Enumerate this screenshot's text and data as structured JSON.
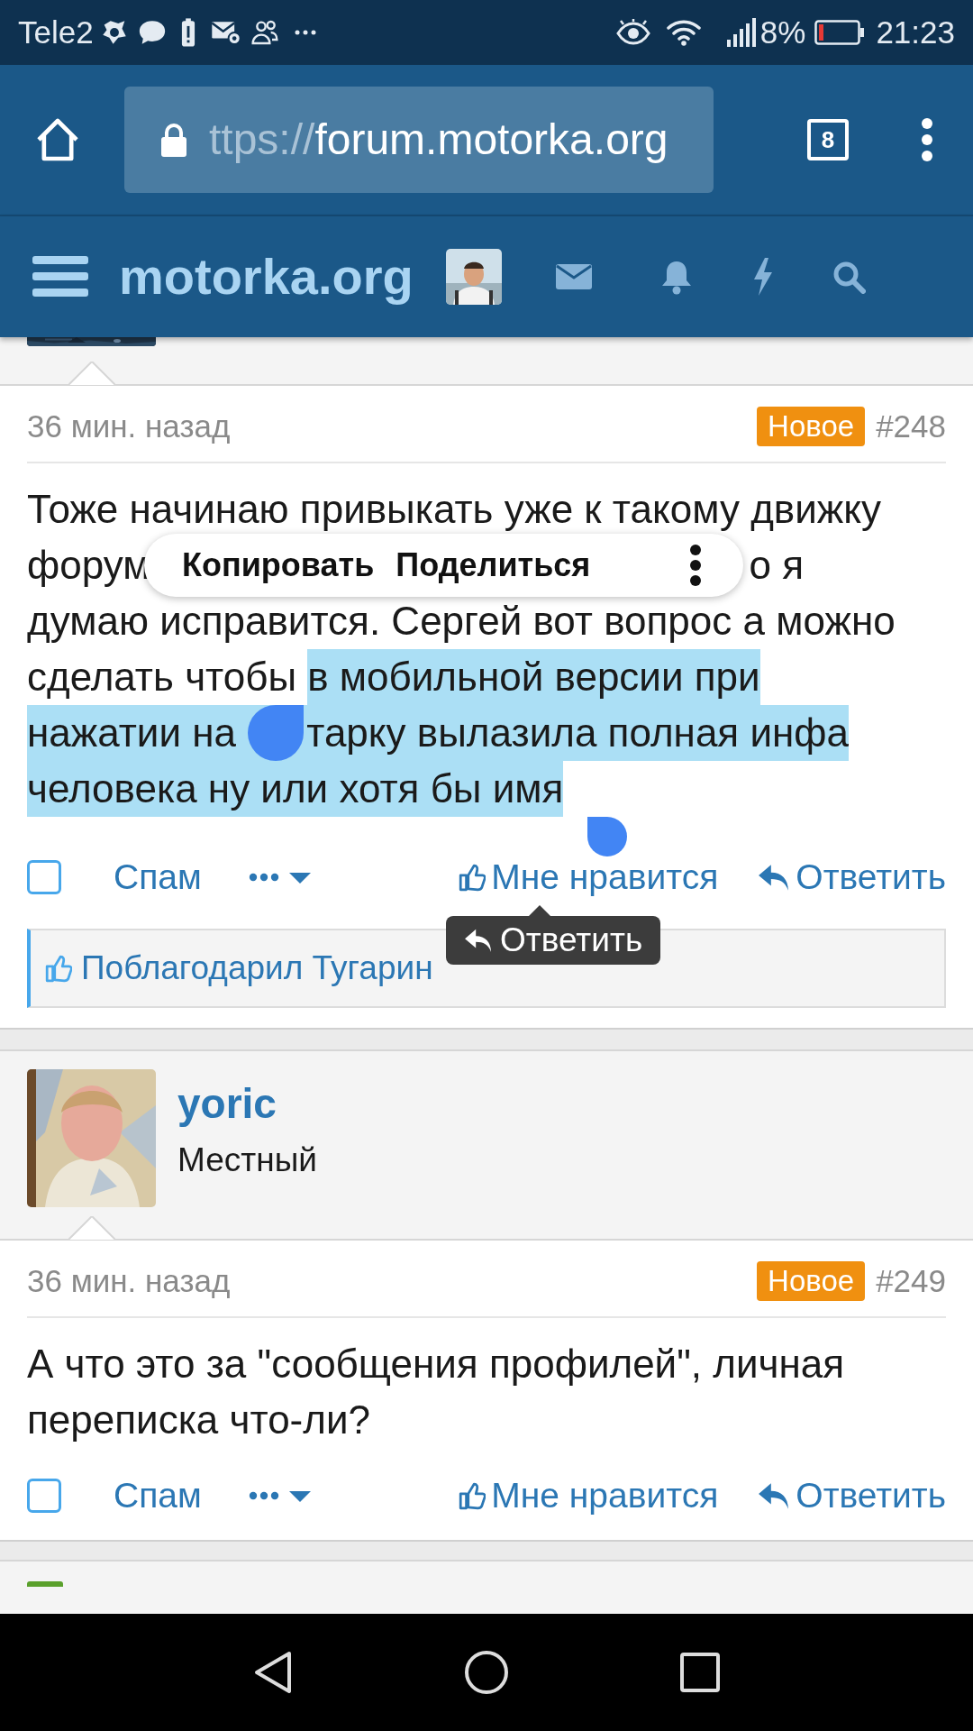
{
  "status_bar": {
    "carrier": "Tele2",
    "battery_percent": "8%",
    "time": "21:23"
  },
  "browser": {
    "url_scheme": "ttps://",
    "url_host": "forum.motorka.org",
    "tab_count": "8"
  },
  "forum_header": {
    "site_name": "motorka.org"
  },
  "posts": [
    {
      "time": "36 мин. назад",
      "badge": "Новое",
      "number": "#248",
      "lines": [
        {
          "kind": "text",
          "segments": [
            {
              "text": "Тоже начинаю привыкать уже к такому движку",
              "selected": false
            }
          ]
        },
        {
          "kind": "split",
          "segments": [
            {
              "text": "форум",
              "selected": false
            },
            {
              "text": "о я",
              "selected": false
            }
          ]
        },
        {
          "kind": "text",
          "segments": [
            {
              "text": "думаю исправится. Сергей вот вопрос а можно",
              "selected": false
            }
          ]
        },
        {
          "kind": "text",
          "segments": [
            {
              "text": "сделать чтобы ",
              "selected": false
            },
            {
              "text": "в мобильной версии при",
              "selected": true
            }
          ]
        },
        {
          "kind": "handle",
          "segments": [
            {
              "text": "нажатии на ",
              "selected": true
            },
            {
              "text": "тарку вылазила полная инфа",
              "selected": true
            }
          ]
        },
        {
          "kind": "text",
          "segments": [
            {
              "text": "человека ну или хотя бы имя",
              "selected": true
            }
          ]
        }
      ],
      "actions": {
        "checked": false,
        "spam": "Спам",
        "like": "Мне нравится",
        "reply": "Ответить"
      },
      "thanks": "Поблагодарил Тугарин"
    },
    {
      "author": {
        "name": "yoric",
        "title": "Местный"
      },
      "time": "36 мин. назад",
      "badge": "Новое",
      "number": "#249",
      "lines": [
        {
          "kind": "text",
          "segments": [
            {
              "text": "А что это за \"сообщения профилей\", личная",
              "selected": false
            }
          ]
        },
        {
          "kind": "text",
          "segments": [
            {
              "text": "переписка что-ли?",
              "selected": false
            }
          ]
        }
      ],
      "actions": {
        "checked": false,
        "spam": "Спам",
        "like": "Мне нравится",
        "reply": "Ответить"
      }
    }
  ],
  "selection_menu": {
    "items": [
      "Копировать",
      "Поделиться"
    ]
  },
  "tooltip": "Ответить"
}
